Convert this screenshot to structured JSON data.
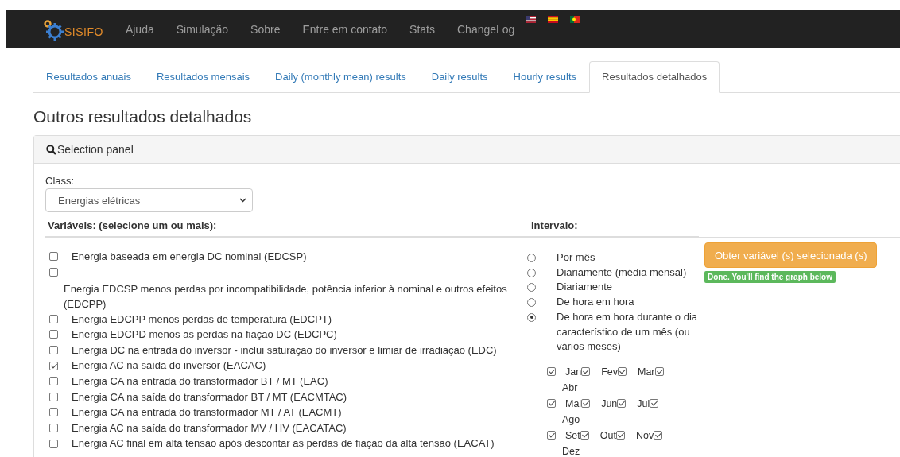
{
  "navbar": {
    "brand": "SISIFO",
    "links": [
      "Ajuda",
      "Simulação",
      "Sobre",
      "Entre em contato",
      "Stats",
      "ChangeLog"
    ],
    "flags": [
      {
        "kind": "us"
      },
      {
        "kind": "es"
      },
      {
        "kind": "pt"
      }
    ]
  },
  "tabs": [
    {
      "label": "Resultados anuais",
      "selected": false
    },
    {
      "label": "Resultados mensais",
      "selected": false
    },
    {
      "label": "Daily (monthly mean) results",
      "selected": false
    },
    {
      "label": "Daily results",
      "selected": false
    },
    {
      "label": "Hourly results",
      "selected": false
    },
    {
      "label": "Resultados detalhados",
      "selected": true
    }
  ],
  "heading": "Outros resultados detalhados",
  "panel": {
    "title": "Selection panel",
    "class_label": "Class:",
    "class_value": "Energias elétricas",
    "variables_heading": "Variáveis: (selecione um ou mais):",
    "interval_heading": "Intervalo:",
    "variables": [
      {
        "label": "Energia baseada em energia DC nominal (EDCSP)",
        "checked": false,
        "kind": "inline"
      },
      {
        "label": "Energia EDCSP menos perdas por incompatibilidade, potência inferior à nominal e outros efeitos (EDCPP)",
        "checked": false,
        "kind": "block"
      },
      {
        "label": "Energia EDCPP menos perdas de temperatura (EDCPT)",
        "checked": false,
        "kind": "inline"
      },
      {
        "label": "Energia EDCPD menos as perdas na fiação DC (EDCPC)",
        "checked": false,
        "kind": "inline"
      },
      {
        "label": "Energia DC na entrada do inversor - inclui saturação do inversor e limiar de irradiação (EDC)",
        "checked": false,
        "kind": "inline"
      },
      {
        "label": "Energia AC na saída do inversor (EACAC)",
        "checked": true,
        "kind": "inline"
      },
      {
        "label": "Energia CA na entrada do transformador BT / MT (EAC)",
        "checked": false,
        "kind": "inline"
      },
      {
        "label": "Energia CA na saída do transformador BT / MT (EACMTAC)",
        "checked": false,
        "kind": "inline"
      },
      {
        "label": "Energia CA na entrada do transformador MT / AT (EACMT)",
        "checked": false,
        "kind": "inline"
      },
      {
        "label": "Energia AC na saída do transformador MV / HV (EACATAC)",
        "checked": false,
        "kind": "inline"
      },
      {
        "label": "Energia AC final em alta tensão após descontar as perdas de fiação da alta tensão (EACAT)",
        "checked": false,
        "kind": "inline"
      }
    ],
    "intervals": [
      {
        "label": "Por mês",
        "selected": false
      },
      {
        "label": "Diariamente (média mensal)",
        "selected": false
      },
      {
        "label": "Diariamente",
        "selected": false
      },
      {
        "label": "De hora em hora",
        "selected": false
      },
      {
        "label": "De hora em hora durante o dia característico de um mês (ou vários meses)",
        "selected": true
      }
    ],
    "month_rows": [
      {
        "checked": true,
        "months": [
          {
            "label": "Jan",
            "checked": true
          },
          {
            "label": "Fev",
            "checked": true
          },
          {
            "label": "Mar",
            "checked": true
          }
        ],
        "wrapped_label": "Abr"
      },
      {
        "checked": true,
        "months": [
          {
            "label": "Mai",
            "checked": true
          },
          {
            "label": "Jun",
            "checked": true
          },
          {
            "label": "Jul",
            "checked": true
          }
        ],
        "wrapped_label": "Ago"
      },
      {
        "checked": true,
        "months": [
          {
            "label": "Set",
            "checked": true
          },
          {
            "label": "Out",
            "checked": true
          },
          {
            "label": "Nov",
            "checked": true
          }
        ],
        "wrapped_label": "Dez"
      }
    ],
    "submit_button": "Obter variável (s) selecionada (s)",
    "status_badge": "Done. You'll find the graph below"
  }
}
